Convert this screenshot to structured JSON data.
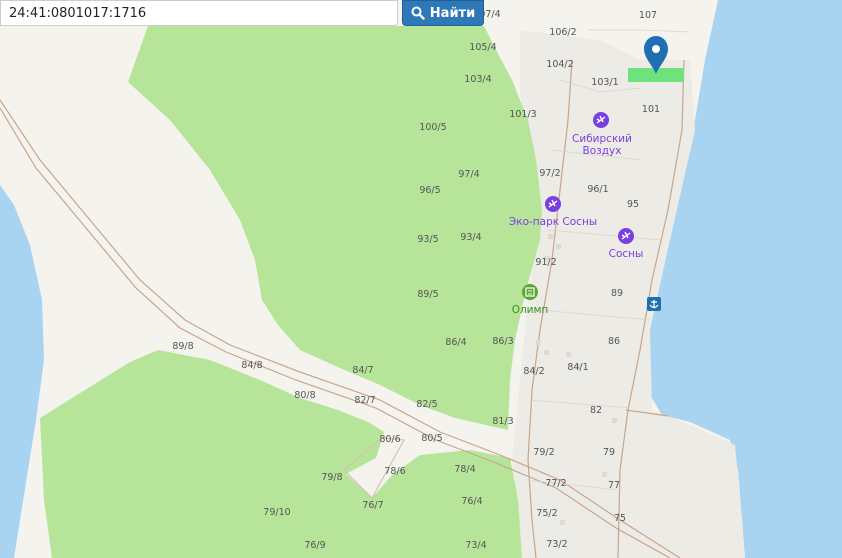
{
  "search": {
    "value": "24:41:0801017:1716",
    "button_label": "Найти",
    "button_icon": "search-icon"
  },
  "colors": {
    "forest": "#b6e59a",
    "water": "#a8d4f2",
    "land": "#f5f3ee",
    "settlement": "#ecebe6",
    "poi_purple": "#7a3fe0",
    "poi_green": "#5aa832",
    "marker": "#1f6fb2",
    "highlighted_parcel": "#6fe27d"
  },
  "pois": {
    "sibirsky": {
      "label_1": "Сибирский",
      "label_2": "Воздух",
      "icon": "airfield-icon"
    },
    "ekopark": {
      "label": "Эко-парк Сосны",
      "icon": "airfield-icon"
    },
    "sosny": {
      "label": "Сосны",
      "icon": "airfield-icon"
    },
    "olimp": {
      "label": "Олимп",
      "icon": "building-icon"
    }
  },
  "marker": {
    "icon": "location-pin-icon"
  },
  "anchor": {
    "icon": "anchor-icon"
  },
  "plots": {
    "p107": "107",
    "p106_2": "106/2",
    "p104_2": "104/2",
    "p103_1": "103/1",
    "p101": "101",
    "p97_4a": "97/4",
    "p105_4": "105/4",
    "p103_4": "103/4",
    "p101_3": "101/3",
    "p100_5": "100/5",
    "p97_4b": "97/4",
    "p97_2": "97/2",
    "p96_5": "96/5",
    "p96_1": "96/1",
    "p95": "95",
    "p93_5": "93/5",
    "p93_4": "93/4",
    "p91_2": "91/2",
    "p89_5": "89/5",
    "p89": "89",
    "p86_4": "86/4",
    "p86_3": "86/3",
    "p86": "86",
    "p89_8": "89/8",
    "p84_8": "84/8",
    "p84_7": "84/7",
    "p84_2": "84/2",
    "p84_1": "84/1",
    "p80_8": "80/8",
    "p82_7": "82/7",
    "p82_5": "82/5",
    "p82": "82",
    "p81_3": "81/3",
    "p80_6": "80/6",
    "p80_5": "80/5",
    "p79_2": "79/2",
    "p79": "79",
    "p79_8": "79/8",
    "p78_6": "78/6",
    "p78_4": "78/4",
    "p77_2": "77/2",
    "p77": "77",
    "p76_7": "76/7",
    "p76_4": "76/4",
    "p79_10": "79/10",
    "p75_2": "75/2",
    "p75": "75",
    "p76_9": "76/9",
    "p73_4": "73/4",
    "p73_2": "73/2"
  }
}
